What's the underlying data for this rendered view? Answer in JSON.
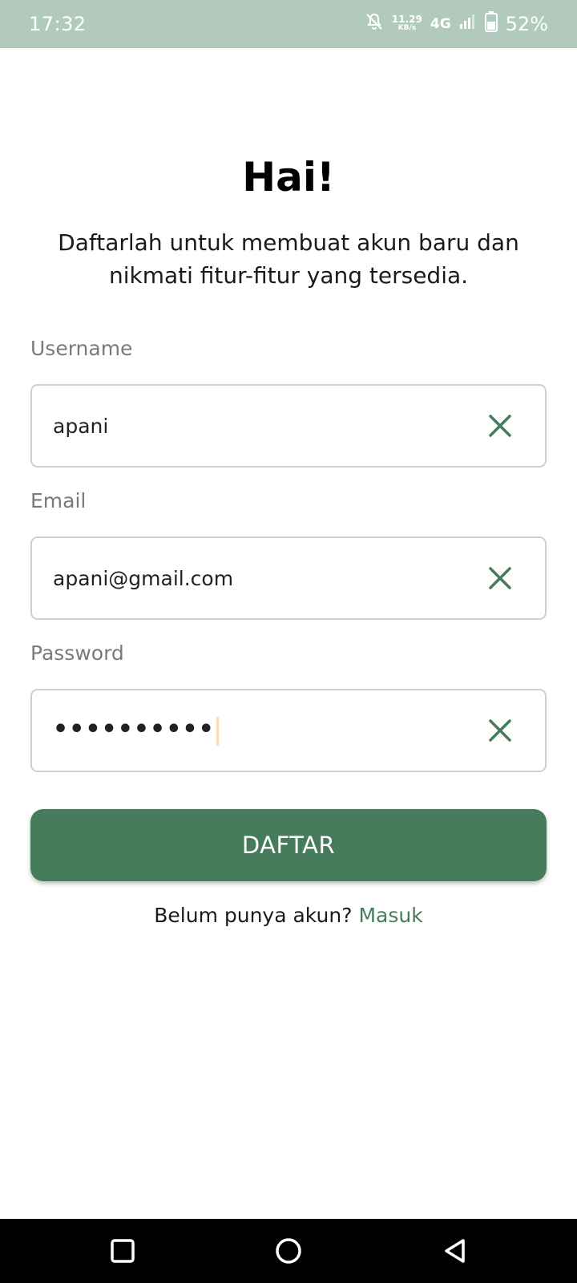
{
  "status_bar": {
    "time": "17:32",
    "net_speed_value": "11.29",
    "net_speed_unit": "KB/s",
    "network_type": "4G",
    "battery": "52%",
    "icons": [
      "bell-off-icon",
      "signal-icon",
      "battery-icon"
    ]
  },
  "header": {
    "title": "Hai!",
    "subtitle": "Daftarlah untuk membuat akun baru dan nikmati fitur-fitur yang tersedia."
  },
  "form": {
    "username": {
      "label": "Username",
      "value": "apani"
    },
    "email": {
      "label": "Email",
      "value": "apani@gmail.com"
    },
    "password": {
      "label": "Password",
      "value": "••••••••••"
    },
    "clear_icon": "close-icon",
    "submit_label": "DAFTAR"
  },
  "footer": {
    "prompt": "Belum punya akun?",
    "link_label": "Masuk"
  },
  "nav_bar": {
    "icons": [
      "recents-square-icon",
      "home-circle-icon",
      "back-triangle-icon"
    ]
  },
  "colors": {
    "accent": "#467c5c",
    "status_bar": "#b2cabd",
    "border": "#cfcfcf",
    "label": "#7a7a7a"
  }
}
